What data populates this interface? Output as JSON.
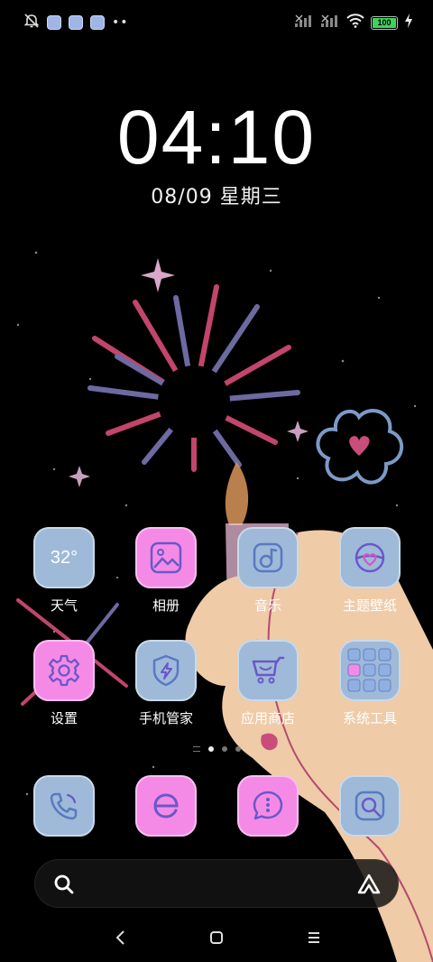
{
  "status_bar": {
    "icons_left": [
      "bell-off-icon",
      "notification-icon",
      "notification-icon",
      "notification-icon",
      "more-dots-icon"
    ],
    "icons_right": [
      "signal-off-icon",
      "signal-off-icon",
      "wifi-icon",
      "battery-icon",
      "charging-icon"
    ],
    "battery_level": "100"
  },
  "lockscreen": {
    "time": "04:10",
    "date": "08/09 星期三"
  },
  "apps": [
    {
      "label": "天气",
      "icon": "weather-icon",
      "icon_text": "32°",
      "color": "#9ebad8"
    },
    {
      "label": "相册",
      "icon": "gallery-icon",
      "color": "#f58ae6"
    },
    {
      "label": "音乐",
      "icon": "music-icon",
      "color": "#9ebad8"
    },
    {
      "label": "主题壁纸",
      "icon": "themes-icon",
      "color": "#9ebad8"
    },
    {
      "label": "设置",
      "icon": "settings-gear-icon",
      "color": "#f58ae6"
    },
    {
      "label": "手机管家",
      "icon": "security-shield-icon",
      "color": "#9ebad8"
    },
    {
      "label": "应用商店",
      "icon": "app-store-cart-icon",
      "color": "#9ebad8"
    },
    {
      "label": "系统工具",
      "icon": "folder-icon",
      "color": "#9ebad8"
    }
  ],
  "dock": [
    {
      "icon": "phone-icon",
      "color": "#9ebad8"
    },
    {
      "icon": "browser-icon",
      "color": "#f58ae6"
    },
    {
      "icon": "messages-icon",
      "color": "#f58ae6"
    },
    {
      "icon": "camera-icon",
      "color": "#9ebad8"
    }
  ],
  "pager": {
    "pages": 3,
    "current": 1
  },
  "search": {
    "left_icon": "search-icon",
    "right_icon": "assistant-icon"
  },
  "nav": {
    "back": "back-icon",
    "home": "home-icon",
    "recents": "menu-icon"
  }
}
